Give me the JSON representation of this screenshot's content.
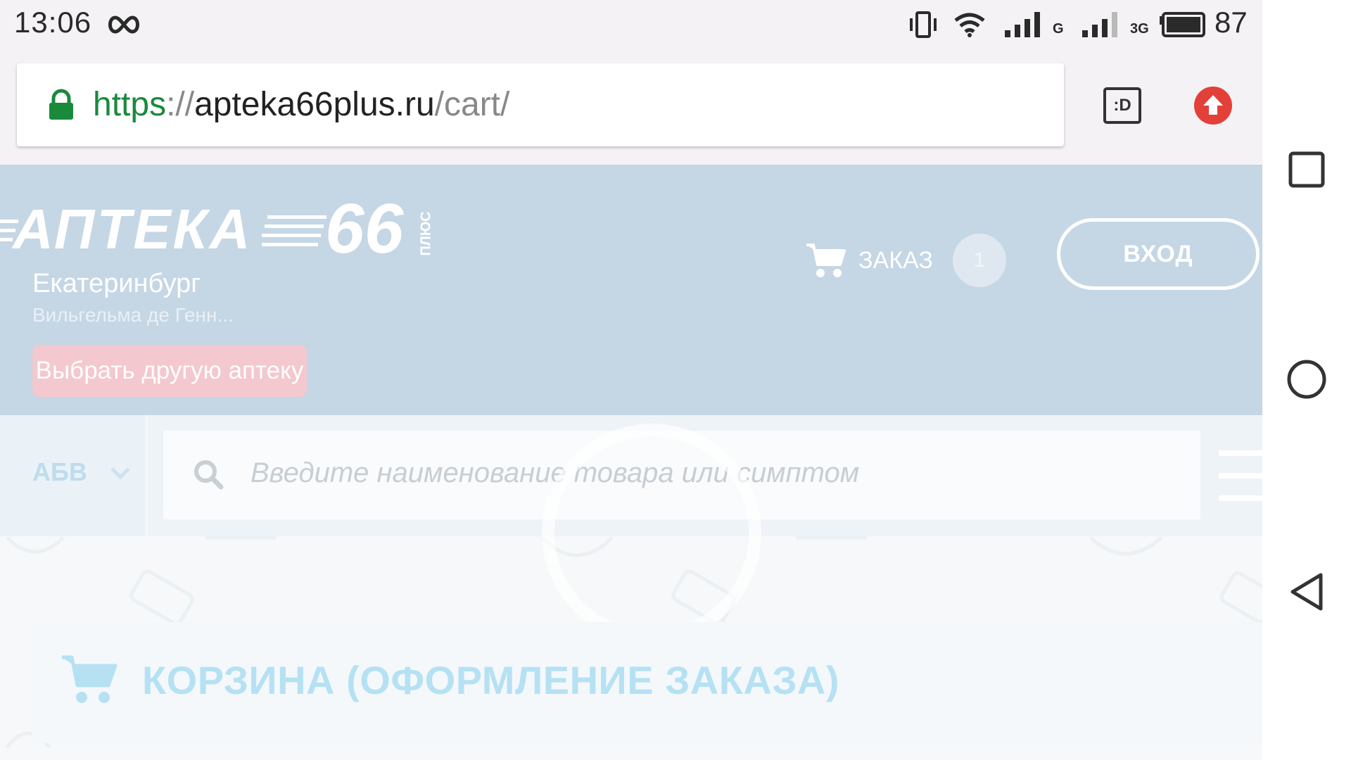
{
  "status_bar": {
    "time": "13:06",
    "network_1": "G",
    "network_2": "3G",
    "battery": "87",
    "icons": [
      "infinity-icon",
      "vibrate-icon",
      "wifi-icon",
      "signal-icon",
      "signal-icon",
      "battery-icon"
    ]
  },
  "browser": {
    "url_scheme": "https",
    "url_sep": "://",
    "url_host": "apteka66plus.ru",
    "url_path": "/cart/",
    "tab_switcher_label": ":D",
    "icons": [
      "lock-icon",
      "tab-switcher-icon",
      "update-icon"
    ]
  },
  "site": {
    "logo": {
      "word": "АПТЕКА",
      "number": "66",
      "plus": "ПЛЮС"
    },
    "city": "Екатеринбург",
    "address": "Вильгельма де Генн...",
    "choose_pharmacy": "Выбрать другую аптеку",
    "order_label": "ЗАКАЗ",
    "order_count": "1",
    "login": "ВХОД",
    "abc_filter": "АБВ",
    "search_placeholder": "Введите наименование товара или симптом",
    "cart_title": "КОРЗИНА (ОФОРМЛЕНИЕ ЗАКАЗА)"
  },
  "colors": {
    "header_bg": "#c5d6e5",
    "url_green": "#198a3c",
    "update_red": "#e3403a",
    "choose_btn": "#f3c8ce",
    "cart_title": "#b5e1f3"
  },
  "navbar": {
    "icons": [
      "recent-apps-icon",
      "home-icon",
      "back-icon"
    ]
  }
}
